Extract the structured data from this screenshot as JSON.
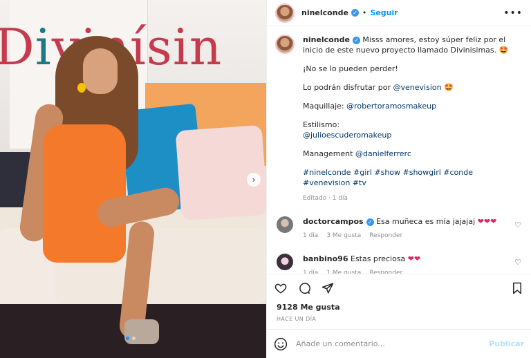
{
  "post": {
    "username": "ninelconde",
    "separator": "•",
    "follow_label": "Seguir",
    "more_label": "•••"
  },
  "caption": {
    "username": "ninelconde",
    "line1": "Misss amores, estoy súper feliz por el inicio de este nuevo proyecto llamado Divinisimas. 🤩",
    "line2": "¡No se lo pueden perder!",
    "line3_prefix": "Lo podrán disfrutar por ",
    "line3_mention": "@venevision",
    "line3_suffix": " 🤩",
    "line4_prefix": "Maquillaje: ",
    "line4_mention": "@robertoramosmakeup",
    "line5_label": "Estilismo:",
    "line5_mention": "@julioescuderomakeup",
    "line6_prefix": "Management ",
    "line6_mention": "@danielferrerc",
    "hashtags": "#ninelconde #girl #show #showgirl #conde #venevision #tv",
    "meta": "Editado · 1 día"
  },
  "comments": [
    {
      "username": "doctorcampos",
      "text": " Esa muñeca es mía jajajaj ",
      "hearts": "❤❤❤",
      "time": "1 día",
      "likes": "3 Me gusta",
      "reply": "Responder"
    },
    {
      "username": "banbino96",
      "text": " Estas preciosa ",
      "hearts": "❤❤",
      "time": "1 día",
      "likes": "1 Me gusta",
      "reply": "Responder"
    }
  ],
  "likes_count": "9128 Me gusta",
  "timestamp": "HACE UN DÍA",
  "composer": {
    "placeholder": "Añade un comentario...",
    "publish_label": "Publicar"
  },
  "image": {
    "brand_text_prefix": "D",
    "brand_text_o": "i",
    "brand_text_rest": "vinísin"
  },
  "icons": {
    "like": "heart-icon",
    "comment": "comment-icon",
    "share": "share-icon",
    "save": "bookmark-icon",
    "emoji": "emoji-icon",
    "next": "chevron-right-icon"
  },
  "colors": {
    "link": "#00376b",
    "follow": "#0095f6",
    "verified": "#3897f0",
    "meta": "#8e8e8e",
    "heart_red": "#e0245e"
  }
}
